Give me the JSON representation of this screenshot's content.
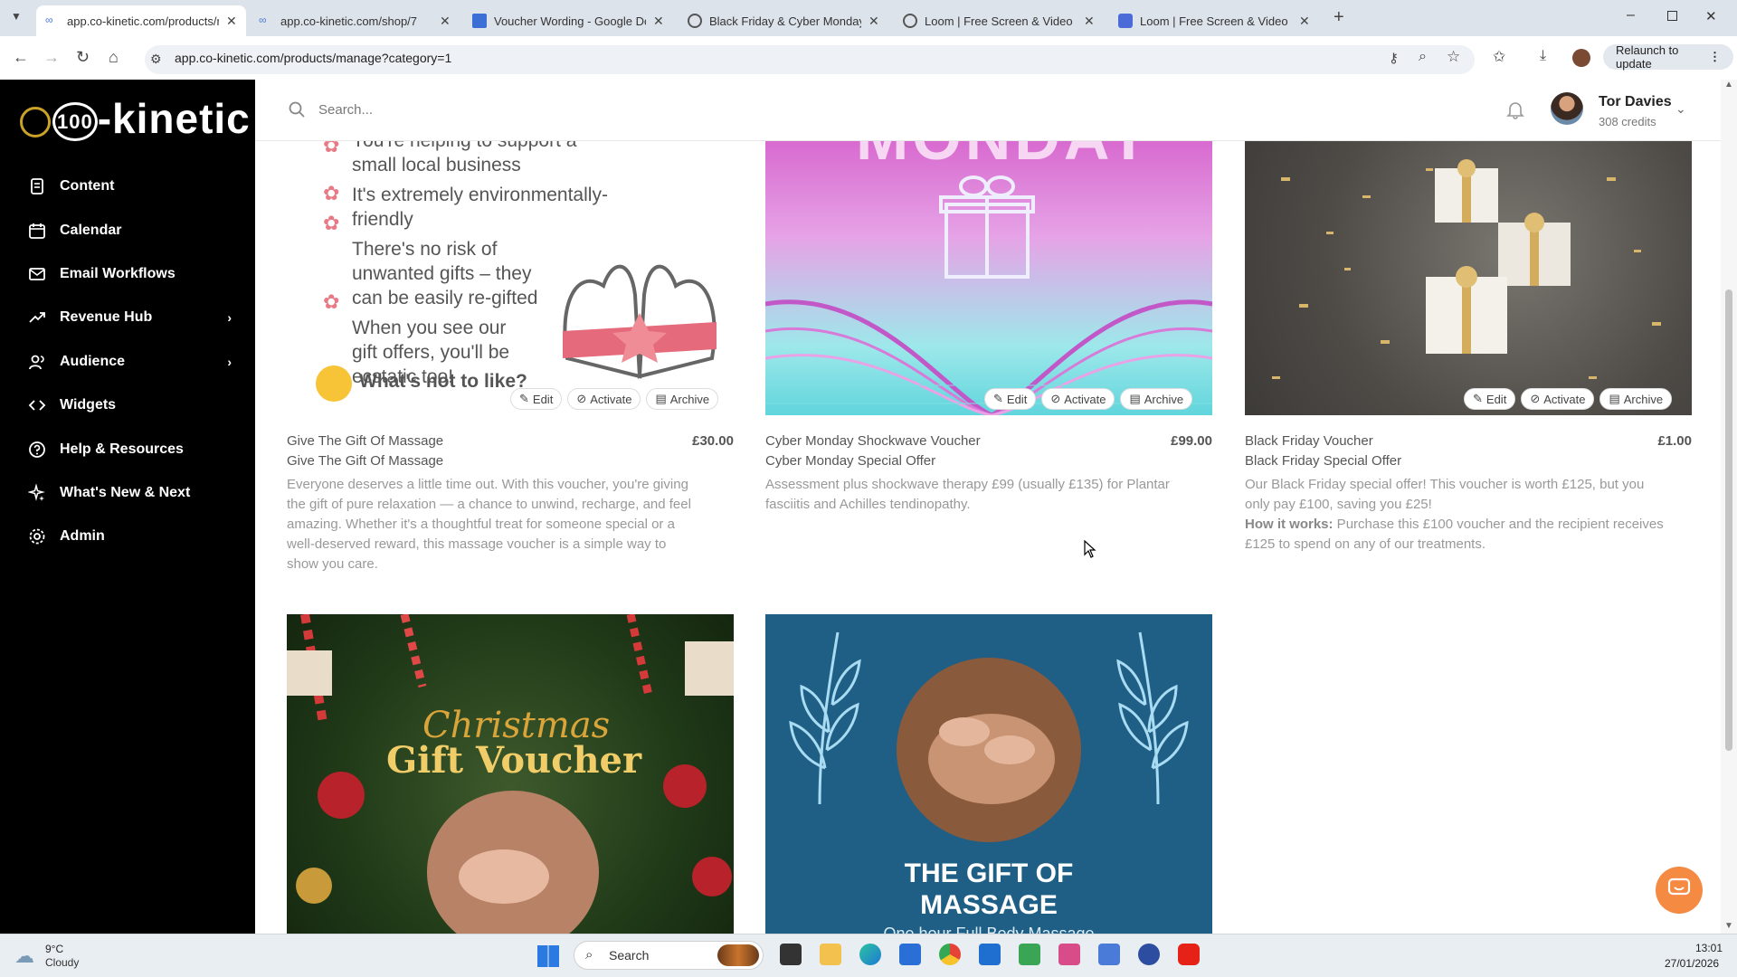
{
  "browser": {
    "tabs": [
      {
        "title": "app.co-kinetic.com/products/m",
        "active": true
      },
      {
        "title": "app.co-kinetic.com/shop/7",
        "active": false
      },
      {
        "title": "Voucher Wording - Google Doc",
        "active": false
      },
      {
        "title": "Black Friday & Cyber Monday V",
        "active": false
      },
      {
        "title": "Loom | Free Screen & Video Re",
        "active": false
      },
      {
        "title": "Loom | Free Screen & Video Re",
        "active": false
      }
    ],
    "url": "app.co-kinetic.com/products/manage?category=1",
    "relaunch_label": "Relaunch to update"
  },
  "sidebar": {
    "logo_text": "-kinetic",
    "logo_badge": "100",
    "items": [
      {
        "label": "Content",
        "icon": "document-icon",
        "has_arrow": false
      },
      {
        "label": "Calendar",
        "icon": "calendar-icon",
        "has_arrow": false
      },
      {
        "label": "Email Workflows",
        "icon": "mail-icon",
        "has_arrow": false
      },
      {
        "label": "Revenue Hub",
        "icon": "trend-icon",
        "has_arrow": true
      },
      {
        "label": "Audience",
        "icon": "users-icon",
        "has_arrow": true
      },
      {
        "label": "Widgets",
        "icon": "code-icon",
        "has_arrow": false
      },
      {
        "label": "Help & Resources",
        "icon": "help-icon",
        "has_arrow": false
      },
      {
        "label": "What's New & Next",
        "icon": "sparkle-icon",
        "has_arrow": false
      },
      {
        "label": "Admin",
        "icon": "gear-icon",
        "has_arrow": false
      }
    ]
  },
  "topbar": {
    "search_placeholder": "Search...",
    "user_name": "Tor Davies",
    "user_credits": "308 credits"
  },
  "actions": {
    "edit": "Edit",
    "activate": "Activate",
    "archive": "Archive"
  },
  "products": [
    {
      "title": "Give The Gift Of Massage",
      "subtitle": "Give The Gift Of Massage",
      "price": "£30.00",
      "description": "Everyone deserves a little time out. With this voucher, you're giving the gift of pure relaxation — a chance to unwind, recharge, and feel amazing. Whether it's a thoughtful treat for someone special or a well-deserved reward, this massage voucher is a simple way to show you care.",
      "image_lines": [
        "You're helping to support a small local business",
        "It's extremely environmentally-friendly",
        "There's no risk of unwanted gifts – they can be easily re-gifted",
        "When you see our gift offers, you'll be ecstatic too!"
      ],
      "image_footer": "What's not to like?"
    },
    {
      "title": "Cyber Monday Shockwave Voucher",
      "subtitle": "Cyber Monday Special Offer",
      "price": "£99.00",
      "description": "Assessment plus shockwave therapy £99 (usually £135) for Plantar fasciitis and Achilles tendinopathy.",
      "image_text": "MONDAY"
    },
    {
      "title": "Black Friday Voucher",
      "subtitle": "Black Friday Special Offer",
      "price": "£1.00",
      "description": "Our Black Friday special offer! This voucher is worth £125, but you only pay £100, saving you £25!",
      "how_label": "How it works:",
      "how_text": " Purchase this £100 voucher and the recipient receives £125 to spend on any of our treatments."
    },
    {
      "image_script": "Christmas",
      "image_title": "Gift Voucher"
    },
    {
      "image_title_1": "THE GIFT OF",
      "image_title_2": "MASSAGE",
      "image_sub": "One hour Full Body Massage"
    }
  ],
  "taskbar": {
    "temp": "9°C",
    "weather": "Cloudy",
    "search_label": "Search",
    "time": "13:01",
    "date": "27/01/2026"
  },
  "colors": {
    "accent": "#f58a42",
    "sidebar_bg": "#000000",
    "voucher_blue": "#1f5f86"
  }
}
